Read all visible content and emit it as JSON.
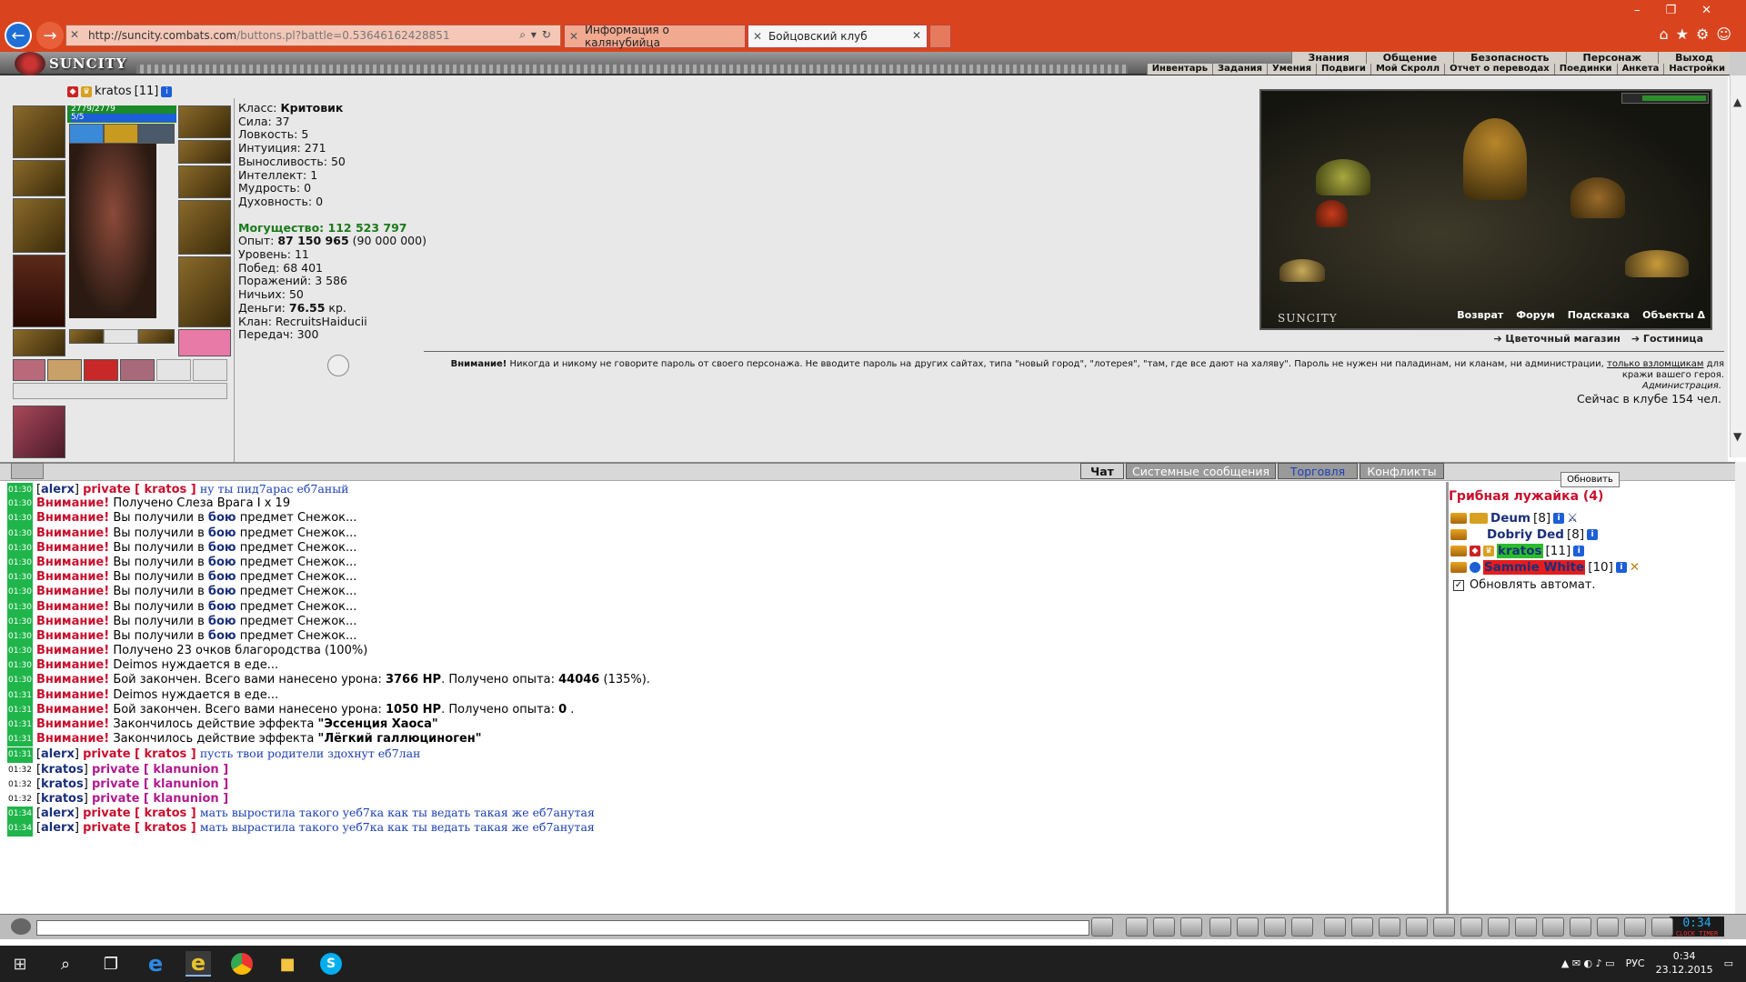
{
  "browser": {
    "url_host": "http://suncity.combats.com",
    "url_path": "/buttons.pl?battle=0.53646162428851",
    "tabs": [
      {
        "label": "Информация о калянубийца"
      },
      {
        "label": "Бойцовский клуб"
      }
    ]
  },
  "game_nav": {
    "logo": "SUNCITY",
    "row1": [
      "Знания",
      "Общение",
      "Безопасность",
      "Персонаж",
      "Выход"
    ],
    "row2": [
      "Инвентарь",
      "Задания",
      "Умения",
      "Подвиги",
      "Мой Скролл",
      "Отчет о переводах",
      "Поединки",
      "Анкета",
      "Настройки"
    ]
  },
  "character": {
    "name": "kratos",
    "level": "[11]",
    "hp": "2779/2779",
    "mp": "5/5",
    "stats": [
      {
        "label": "Класс:",
        "value": "Критовик"
      },
      {
        "label": "Сила:",
        "value": "37"
      },
      {
        "label": "Ловкость:",
        "value": "5"
      },
      {
        "label": "Интуиция:",
        "value": "271"
      },
      {
        "label": "Выносливость:",
        "value": "50"
      },
      {
        "label": "Интеллект:",
        "value": "1"
      },
      {
        "label": "Мудрость:",
        "value": "0"
      },
      {
        "label": "Духовность:",
        "value": "0"
      }
    ],
    "might_label": "Могущество:",
    "might_value": "112 523 797",
    "exp_label": "Опыт:",
    "exp_value": "87 150 965",
    "exp_next": "(90 000 000)",
    "info": [
      "Уровень: 11",
      "Побед: 68 401",
      "Поражений: 3 586",
      "Ничьих: 50"
    ],
    "money_label": "Деньги:",
    "money_value": "76.55",
    "money_unit": "кр.",
    "clan": "Клан: RecruitsHaiducii",
    "transfers": "Передач: 300"
  },
  "scene": {
    "title": "SUNCITY",
    "links": [
      "Возврат",
      "Форум",
      "Подсказка",
      "Объекты Δ"
    ],
    "shop_links": [
      "➔ Цветочный магазин",
      "➔ Гостиница"
    ]
  },
  "warning": {
    "label": "Внимание!",
    "text1": "Никогда и никому не говорите пароль от своего персонажа. Не вводите пароль на других сайтах, типа \"новый город\", \"лотерея\", \"там, где все дают на халяву\". Пароль не нужен ни паладинам, ни кланам, ни администрации,",
    "link": "только взломщикам",
    "text2": "для кражи вашего героя.",
    "admin": "Администрация.",
    "online": "Сейчас в клубе 154 чел."
  },
  "chat_tabs": [
    "Чат",
    "Системные сообщения",
    "Торговля",
    "Конфликты"
  ],
  "chat": {
    "attention": "Внимание!",
    "private": "private",
    "lines": [
      {
        "t": "01:30",
        "kind": "priv",
        "from": "alerx",
        "to": "kratos",
        "msg": "ну ты пид7арас еб7аный"
      },
      {
        "t": "01:30",
        "kind": "att",
        "msg": "Получено Слеза Врага I x 19"
      },
      {
        "t": "01:30",
        "kind": "drop"
      },
      {
        "t": "01:30",
        "kind": "drop"
      },
      {
        "t": "01:30",
        "kind": "drop"
      },
      {
        "t": "01:30",
        "kind": "drop"
      },
      {
        "t": "01:30",
        "kind": "drop"
      },
      {
        "t": "01:30",
        "kind": "drop"
      },
      {
        "t": "01:30",
        "kind": "drop"
      },
      {
        "t": "01:30",
        "kind": "drop"
      },
      {
        "t": "01:30",
        "kind": "drop"
      },
      {
        "t": "01:30",
        "kind": "att",
        "msg": "Получено 23 очков благородства (100%)"
      },
      {
        "t": "01:30",
        "kind": "att",
        "msg": "Deimos нуждается в еде..."
      },
      {
        "t": "01:30",
        "kind": "end",
        "dmg": "3766 HP",
        "exp": "44046",
        "pct": "(135%)."
      },
      {
        "t": "01:31",
        "kind": "att",
        "msg": "Deimos нуждается в еде..."
      },
      {
        "t": "01:31",
        "kind": "end",
        "dmg": "1050 HP",
        "exp": "0",
        "pct": "."
      },
      {
        "t": "01:31",
        "kind": "eff",
        "effect": "\"Эссенция Хаоса\""
      },
      {
        "t": "01:31",
        "kind": "eff",
        "effect": "\"Лёгкий галлюциноген\""
      },
      {
        "t": "01:31",
        "kind": "priv",
        "from": "alerx",
        "to": "kratos",
        "msg": "пусть твои родители здохнут еб7лан"
      },
      {
        "t": "01:32",
        "kind": "privm",
        "from": "kratos",
        "to": "klanunion",
        "msg": ""
      },
      {
        "t": "01:32",
        "kind": "privm",
        "from": "kratos",
        "to": "klanunion",
        "msg": ""
      },
      {
        "t": "01:32",
        "kind": "privm",
        "from": "kratos",
        "to": "klanunion",
        "msg": ""
      },
      {
        "t": "01:34",
        "kind": "priv",
        "from": "alerx",
        "to": "kratos",
        "msg": "мать выростила такого уеб7ка как ты ведать такая же еб7анутая"
      },
      {
        "t": "01:34",
        "kind": "priv",
        "from": "alerx",
        "to": "kratos",
        "msg": "мать вырастила такого уеб7ка как ты ведать такая же еб7анутая"
      }
    ],
    "drop_pre": "Вы получили в",
    "drop_mid": "бою",
    "drop_post": "предмет Снежок...",
    "end_pre": "Бой закончен. Всего вами нанесено урона:",
    "end_mid": "Получено опыта:",
    "eff_pre": "Закончилось действие эффекта"
  },
  "online_panel": {
    "refresh": "Обновить",
    "room": "Грибная лужайка (4)",
    "users": [
      {
        "name": "Deum",
        "level": "[8]"
      },
      {
        "name": "Dobriy Ded",
        "level": "[8]"
      },
      {
        "name": "kratos",
        "level": "[11]"
      },
      {
        "name": "Sammie White",
        "level": "[10]"
      }
    ],
    "auto_refresh": "Обновлять автомат."
  },
  "clock": {
    "time": "0:34",
    "sub": "CLOCK TIMER"
  },
  "taskbar": {
    "lang": "РУС",
    "time": "0:34",
    "date": "23.12.2015"
  }
}
